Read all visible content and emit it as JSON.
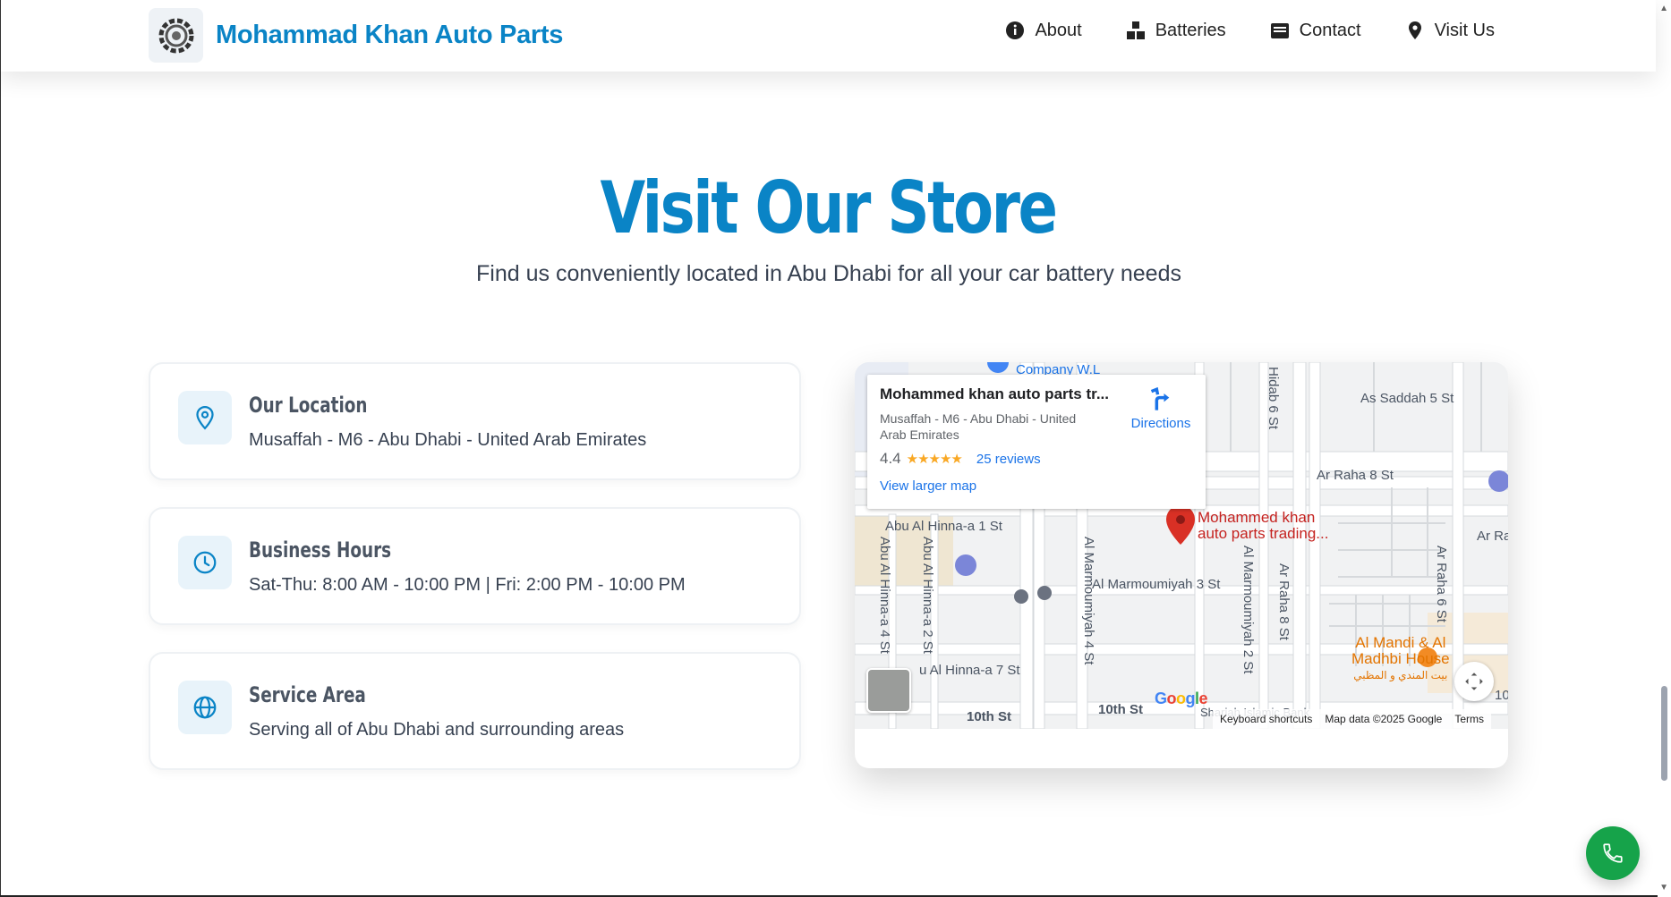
{
  "header": {
    "brand_name": "Mohammad Khan Auto Parts",
    "nav": [
      {
        "label": "About",
        "icon": "info-icon"
      },
      {
        "label": "Batteries",
        "icon": "boxes-icon"
      },
      {
        "label": "Contact",
        "icon": "envelope-icon"
      },
      {
        "label": "Visit Us",
        "icon": "location-pin-icon"
      }
    ]
  },
  "hero": {
    "title": "Visit Our Store",
    "subtitle": "Find us conveniently located in Abu Dhabi for all your car battery needs"
  },
  "cards": [
    {
      "title": "Our Location",
      "text": "Musaffah - M6 - Abu Dhabi - United Arab Emirates",
      "icon": "map-pin-icon"
    },
    {
      "title": "Business Hours",
      "text": "Sat-Thu: 8:00 AM - 10:00 PM | Fri: 2:00 PM - 10:00 PM",
      "icon": "clock-icon"
    },
    {
      "title": "Service Area",
      "text": "Serving all of Abu Dhabi and surrounding areas",
      "icon": "globe-icon"
    }
  ],
  "map": {
    "place_name": "Mohammed khan auto parts tr...",
    "address": "Musaffah - M6 - Abu Dhabi - United Arab Emirates",
    "rating": "4.4",
    "stars": "★★★★★",
    "reviews": "25 reviews",
    "view_larger": "View larger map",
    "directions": "Directions",
    "pin_label_line1": "Mohammed khan",
    "pin_label_line2": "auto parts trading...",
    "poi_line1": "Al Mandi & Al",
    "poi_line2": "Madhbi House",
    "poi_arabic": "بيت المندي و المظبي",
    "streets": {
      "as_saddah": "As Saddah 5 St",
      "ar_raha_8": "Ar Raha 8 St",
      "abu_al_hinna_1": "Abu Al Hinna-a 1 St",
      "al_marmoumiyah_3": "Al Marmoumiyah 3 St",
      "abu_al_hinna_7": "u Al Hinna-a 7 St",
      "tenth_st_a": "10th St",
      "tenth_st_b": "10th St",
      "ar_ra": "Ar Ra",
      "company": "Company W.L",
      "hidab": "Hidab 6 St",
      "abu_al_hinna_4": "Abu Al Hinna-a 4 St",
      "abu_al_hinna_2": "Abu Al Hinna-a 2 St",
      "al_marmoumiyah_4": "Al Marmoumiyah 4 St",
      "al_marmoumiyah_2": "Al Marmoumiyah 2 St",
      "ar_raha_8v": "Ar Raha 8 St",
      "ar_raha_6": "Ar Raha 6 St",
      "bank": "Shariah Islamic Bank",
      "ten": "10"
    },
    "google": "Google",
    "footer": {
      "shortcuts": "Keyboard shortcuts",
      "map_data": "Map data ©2025 Google",
      "terms": "Terms"
    }
  },
  "colors": {
    "brand": "#0a84c6",
    "call_button": "#16a34a",
    "pin": "#d93025"
  }
}
